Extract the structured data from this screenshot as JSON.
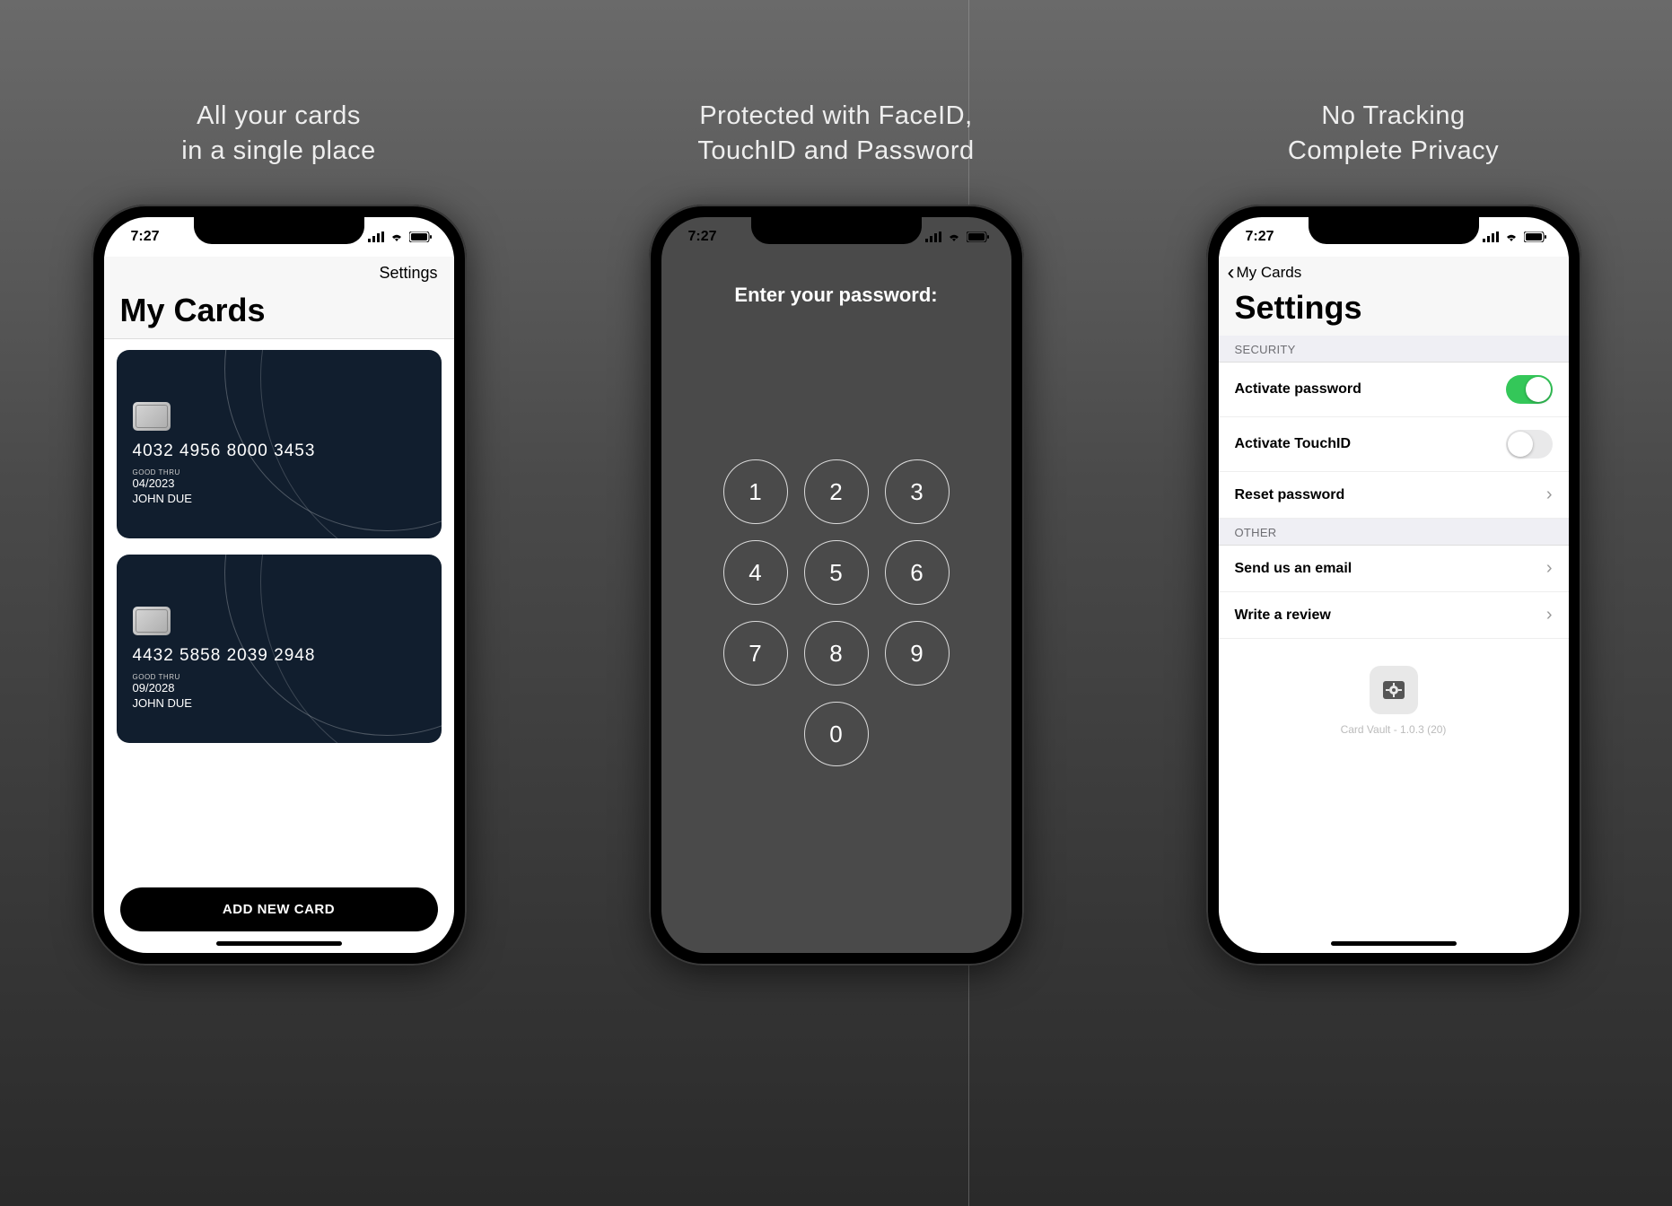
{
  "panels": [
    {
      "caption_line1": "All your cards",
      "caption_line2": "in a single place"
    },
    {
      "caption_line1": "Protected with FaceID,",
      "caption_line2": "TouchID and Password"
    },
    {
      "caption_line1": "No Tracking",
      "caption_line2": "Complete Privacy"
    }
  ],
  "status": {
    "time": "7:27"
  },
  "screen1": {
    "settings_link": "Settings",
    "title": "My Cards",
    "cards": [
      {
        "number": "4032 4956 8000 3453",
        "good_thru_label": "GOOD THRU",
        "expiry": "04/2023",
        "name": "JOHN DUE"
      },
      {
        "number": "4432 5858 2039 2948",
        "good_thru_label": "GOOD THRU",
        "expiry": "09/2028",
        "name": "JOHN DUE"
      }
    ],
    "add_button": "ADD NEW CARD"
  },
  "screen2": {
    "prompt": "Enter your password:",
    "keys": [
      "1",
      "2",
      "3",
      "4",
      "5",
      "6",
      "7",
      "8",
      "9",
      "0"
    ]
  },
  "screen3": {
    "back_label": "My Cards",
    "title": "Settings",
    "section_security": "SECURITY",
    "row_activate_password": "Activate password",
    "row_activate_touchid": "Activate TouchID",
    "row_reset_password": "Reset password",
    "section_other": "OTHER",
    "row_email": "Send us an email",
    "row_review": "Write a review",
    "app_version": "Card Vault - 1.0.3 (20)"
  }
}
